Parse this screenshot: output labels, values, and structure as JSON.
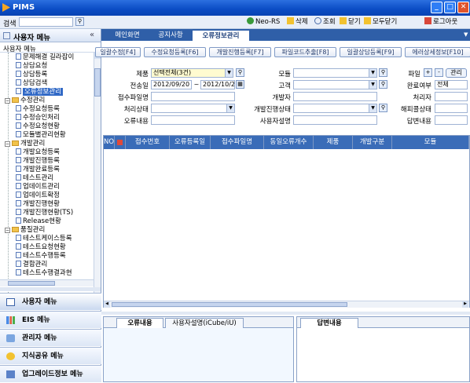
{
  "window": {
    "title": "PIMS",
    "min": "_",
    "max": "□",
    "close": "✕"
  },
  "toolbar": {
    "search_label": "검색",
    "search_value": "",
    "items": [
      {
        "label": "Neo-RS",
        "icon": "globe-icon"
      },
      {
        "label": "삭제",
        "icon": "delete-icon"
      },
      {
        "label": "조회",
        "icon": "search-icon"
      },
      {
        "label": "닫기",
        "icon": "close-icon"
      },
      {
        "label": "모두닫기",
        "icon": "close-all-icon"
      },
      {
        "label": "로그아웃",
        "icon": "logout-icon"
      }
    ]
  },
  "sidebar": {
    "header": "사용자 메뉴",
    "collapse": "«",
    "subheader": "사용자 메뉴",
    "tree": [
      {
        "label": "문제해결 길라잡이",
        "type": "doc",
        "level": 2
      },
      {
        "label": "상담요청",
        "type": "doc",
        "level": 2
      },
      {
        "label": "상담등록",
        "type": "doc",
        "level": 2
      },
      {
        "label": "상담검색",
        "type": "doc",
        "level": 2
      },
      {
        "label": "오류정보관리",
        "type": "doc",
        "level": 2,
        "selected": true
      },
      {
        "label": "수정관리",
        "type": "folder",
        "level": 1
      },
      {
        "label": "수정요청등록",
        "type": "doc",
        "level": 2
      },
      {
        "label": "수정승인처리",
        "type": "doc",
        "level": 2
      },
      {
        "label": "수정요청현황",
        "type": "doc",
        "level": 2
      },
      {
        "label": "모듈별관리현황",
        "type": "doc",
        "level": 2
      },
      {
        "label": "개발관리",
        "type": "folder",
        "level": 1
      },
      {
        "label": "개발요청등록",
        "type": "doc",
        "level": 2
      },
      {
        "label": "개발진행등록",
        "type": "doc",
        "level": 2
      },
      {
        "label": "개발완료등록",
        "type": "doc",
        "level": 2
      },
      {
        "label": "테스트관리",
        "type": "doc",
        "level": 2
      },
      {
        "label": "업데이트관리",
        "type": "doc",
        "level": 2
      },
      {
        "label": "업데이트확정",
        "type": "doc",
        "level": 2
      },
      {
        "label": "개발진행현황",
        "type": "doc",
        "level": 2
      },
      {
        "label": "개발진행현황(TS)",
        "type": "doc",
        "level": 2
      },
      {
        "label": "Release현황",
        "type": "doc",
        "level": 2
      },
      {
        "label": "품질관리",
        "type": "folder",
        "level": 1
      },
      {
        "label": "테스트케이스등록",
        "type": "doc",
        "level": 2
      },
      {
        "label": "테스트요청현황",
        "type": "doc",
        "level": 2
      },
      {
        "label": "테스트수행등록",
        "type": "doc",
        "level": 2
      },
      {
        "label": "결함관리",
        "type": "doc",
        "level": 2
      },
      {
        "label": "테스트수행결과현",
        "type": "doc",
        "level": 2
      }
    ],
    "menus": [
      {
        "label": "사용자 메뉴",
        "icon": "user-menu-icon"
      },
      {
        "label": "EIS 메뉴",
        "icon": "chart-icon"
      },
      {
        "label": "관리자 메뉴",
        "icon": "admin-icon"
      },
      {
        "label": "지식공유 메뉴",
        "icon": "knowledge-icon"
      },
      {
        "label": "업그레이드정보 메뉴",
        "icon": "upgrade-icon"
      }
    ]
  },
  "tabs": [
    {
      "label": "메인화면"
    },
    {
      "label": "공지사항"
    },
    {
      "label": "오류정보관리",
      "active": true
    }
  ],
  "actions": [
    "일괄수정[F4]",
    "수정요청등록[F6]",
    "개발진행등록[F7]",
    "파일코드추출[F8]",
    "일괄상담등록[F9]",
    "에러상세정보[F10]"
  ],
  "form": {
    "product_label": "제품",
    "product_value": "선택전체(3건)",
    "module_label": "모듈",
    "module_value": "",
    "file_label": "파일",
    "add": "+",
    "remove": "-",
    "manage": "관리",
    "sent_label": "전송일",
    "date_from": "2012/09/20",
    "date_sep": "~",
    "date_to": "2012/10/20",
    "customer_label": "고객",
    "customer_value": "",
    "done_label": "완료여부",
    "done_value": "전체",
    "recv_file_label": "접수파일명",
    "recv_file_value": "",
    "developer_label": "개발자",
    "developer_value": "",
    "handler_label": "처리자",
    "handler_value": "",
    "status_label": "처리상태",
    "status_value": "",
    "devstatus_label": "개발진행상태",
    "devstatus_value": "",
    "hotfix_label": "해피콜상태",
    "hotfix_value": "",
    "error_label": "오류내용",
    "error_value": "",
    "user_label": "사용자설명",
    "user_value": "",
    "answer_label": "답변내용",
    "answer_value": ""
  },
  "grid": {
    "columns": [
      "NO",
      "",
      "접수번호",
      "오류등록일",
      "접수파일명",
      "동일오류개수",
      "제품",
      "개발구분",
      "모듈"
    ]
  },
  "bottom": {
    "left_tabs": [
      "오류내용",
      "사용자설명(iCube/iU)"
    ],
    "right_tabs": [
      "답변내용"
    ]
  }
}
